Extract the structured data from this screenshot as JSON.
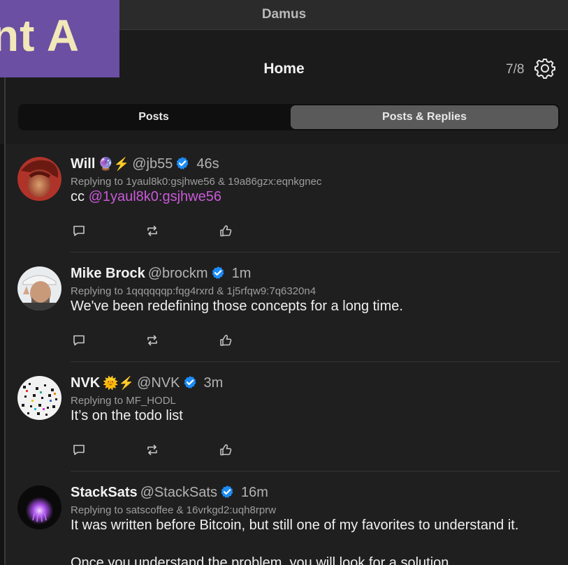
{
  "window": {
    "title": "Damus"
  },
  "overlay_badge": {
    "text": "nt A"
  },
  "header": {
    "title": "Home",
    "counter": "7/8"
  },
  "tabs": [
    {
      "label": "Posts",
      "selected": false
    },
    {
      "label": "Posts & Replies",
      "selected": true
    }
  ],
  "colors": {
    "mention": "#c95ad8",
    "verified": "#1d8cf8",
    "badge_bg": "#6a4fa3"
  },
  "posts": [
    {
      "name": "Will",
      "emojis": "🔮⚡",
      "handle": "@jb55",
      "time": "46s",
      "replying": "Replying to 1yaul8k0:gsjhwe56 & 19a86gzx:eqnkgnec",
      "content_prefix": "cc ",
      "mention": "@1yaul8k0:gsjhwe56",
      "content": ""
    },
    {
      "name": "Mike Brock",
      "emojis": "",
      "handle": "@brockm",
      "time": "1m",
      "replying": "Replying to 1qqqqqqp:fqg4rxrd & 1j5rfqw9:7q6320n4",
      "content": "We've been redefining those concepts for a long time."
    },
    {
      "name": "NVK",
      "emojis": "🌞⚡",
      "handle": "@NVK",
      "time": "3m",
      "replying": "Replying to MF_HODL",
      "content": "It’s on the todo list"
    },
    {
      "name": "StackSats",
      "emojis": "",
      "handle": "@StackSats",
      "time": "16m",
      "replying": "Replying to satscoffee & 16vrkgd2:uqh8rprw",
      "content": "It was written before Bitcoin, but still one of my favorites to understand it.",
      "content2": "Once you understand the problem, you will look for a solution."
    }
  ],
  "icons": {
    "comment": "comment-icon",
    "repost": "repost-icon",
    "like": "like-icon",
    "settings": "gear-icon",
    "verified": "verified-badge-icon"
  }
}
